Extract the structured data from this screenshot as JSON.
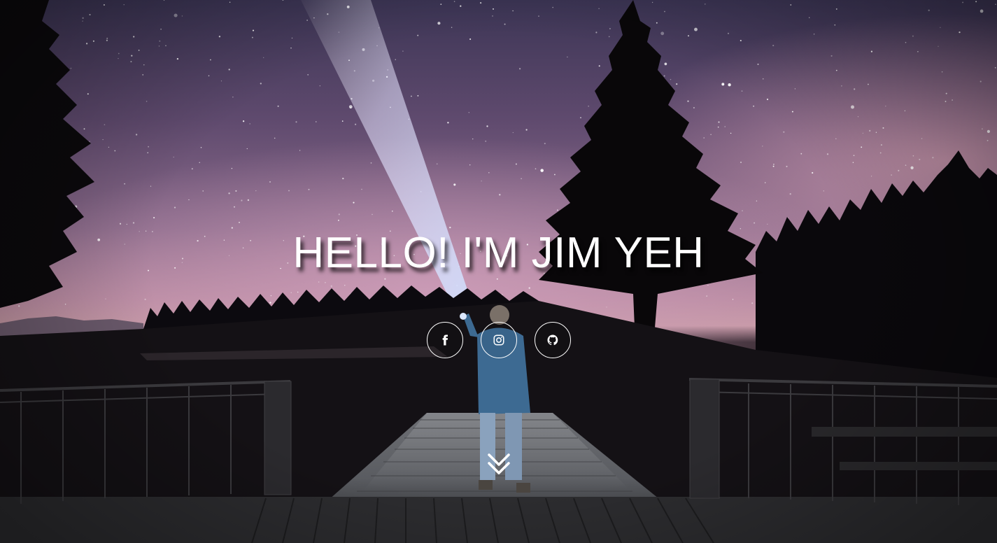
{
  "hero": {
    "title": "HELLO! I'M JIM YEH"
  },
  "social": [
    {
      "network": "facebook",
      "icon": "facebook-icon"
    },
    {
      "network": "instagram",
      "icon": "instagram-icon"
    },
    {
      "network": "github",
      "icon": "github-icon"
    }
  ],
  "scroll": {
    "icon": "double-chevron-down-icon"
  },
  "colors": {
    "text": "#ffffff",
    "sky_top": "#3c3555",
    "sky_glow": "#c79aa5",
    "ground": "#120f14"
  }
}
